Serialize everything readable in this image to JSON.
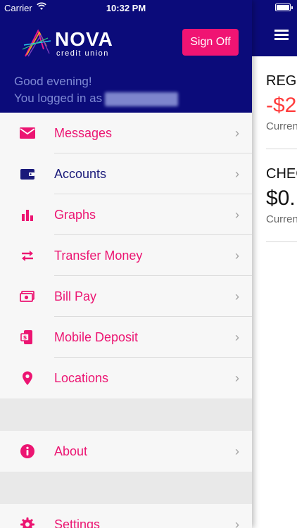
{
  "status_bar": {
    "carrier": "Carrier",
    "time": "10:32 PM"
  },
  "brand": {
    "name": "NOVA",
    "tagline": "credit union"
  },
  "header": {
    "sign_off_label": "Sign Off",
    "greeting": "Good evening!",
    "logged_in_prefix": "You logged in as"
  },
  "menu": {
    "items": [
      {
        "label": "Messages",
        "icon": "envelope-icon"
      },
      {
        "label": "Accounts",
        "icon": "wallet-icon"
      },
      {
        "label": "Graphs",
        "icon": "bar-chart-icon"
      },
      {
        "label": "Transfer Money",
        "icon": "transfer-arrows-icon"
      },
      {
        "label": "Bill Pay",
        "icon": "cash-icon"
      },
      {
        "label": "Mobile Deposit",
        "icon": "mobile-check-icon"
      },
      {
        "label": "Locations",
        "icon": "map-pin-icon"
      },
      {
        "label": "About",
        "icon": "info-icon"
      },
      {
        "label": "Settings",
        "icon": "gear-icon"
      }
    ]
  },
  "background_panel": {
    "accounts": [
      {
        "name": "REGU",
        "balance": "-$2",
        "sub": "Curren"
      },
      {
        "name": "CHEC",
        "balance": "$0.",
        "sub": "Curren"
      }
    ]
  },
  "colors": {
    "navy": "#0b0b7a",
    "accent": "#ec1572",
    "negative": "#ff3b3b"
  }
}
